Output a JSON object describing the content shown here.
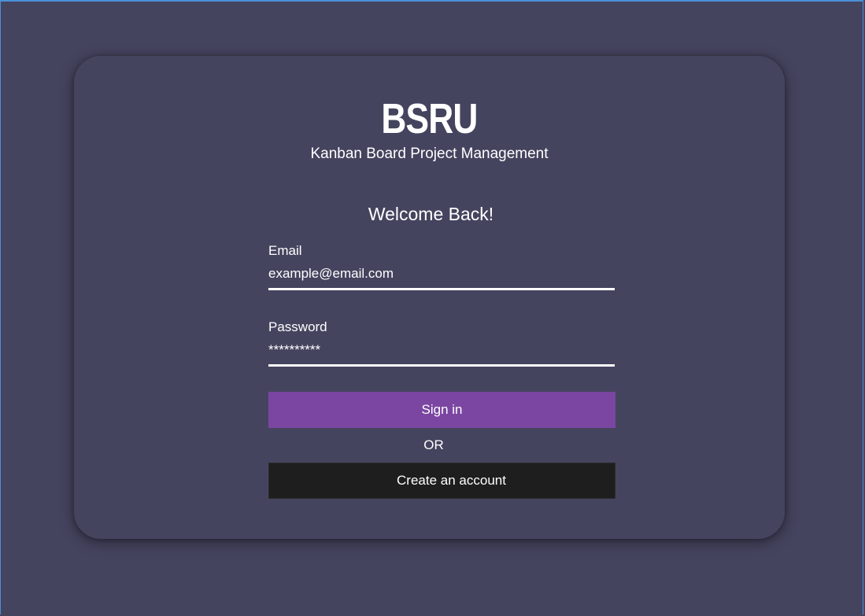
{
  "brand": {
    "name": "BSRU",
    "subtitle": "Kanban Board Project Management"
  },
  "login": {
    "heading": "Welcome Back!",
    "email": {
      "label": "Email",
      "placeholder": "example@email.com"
    },
    "password": {
      "label": "Password",
      "placeholder": "**********"
    },
    "signin_label": "Sign in",
    "or_text": "OR",
    "create_account_label": "Create an account"
  },
  "colors": {
    "background": "#45445f",
    "signin_button": "#7a46a2",
    "create_button": "#1e1e1e",
    "text": "#ffffff"
  }
}
